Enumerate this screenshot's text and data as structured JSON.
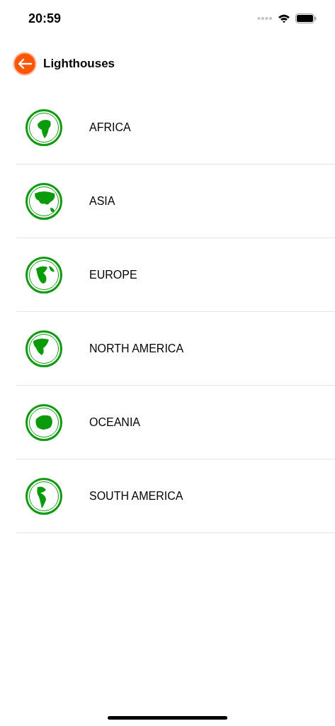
{
  "status_bar": {
    "time": "20:59"
  },
  "nav": {
    "title": "Lighthouses"
  },
  "regions": [
    {
      "label": "AFRICA"
    },
    {
      "label": "ASIA"
    },
    {
      "label": "EUROPE"
    },
    {
      "label": "NORTH AMERICA"
    },
    {
      "label": "OCEANIA"
    },
    {
      "label": "SOUTH AMERICA"
    }
  ]
}
